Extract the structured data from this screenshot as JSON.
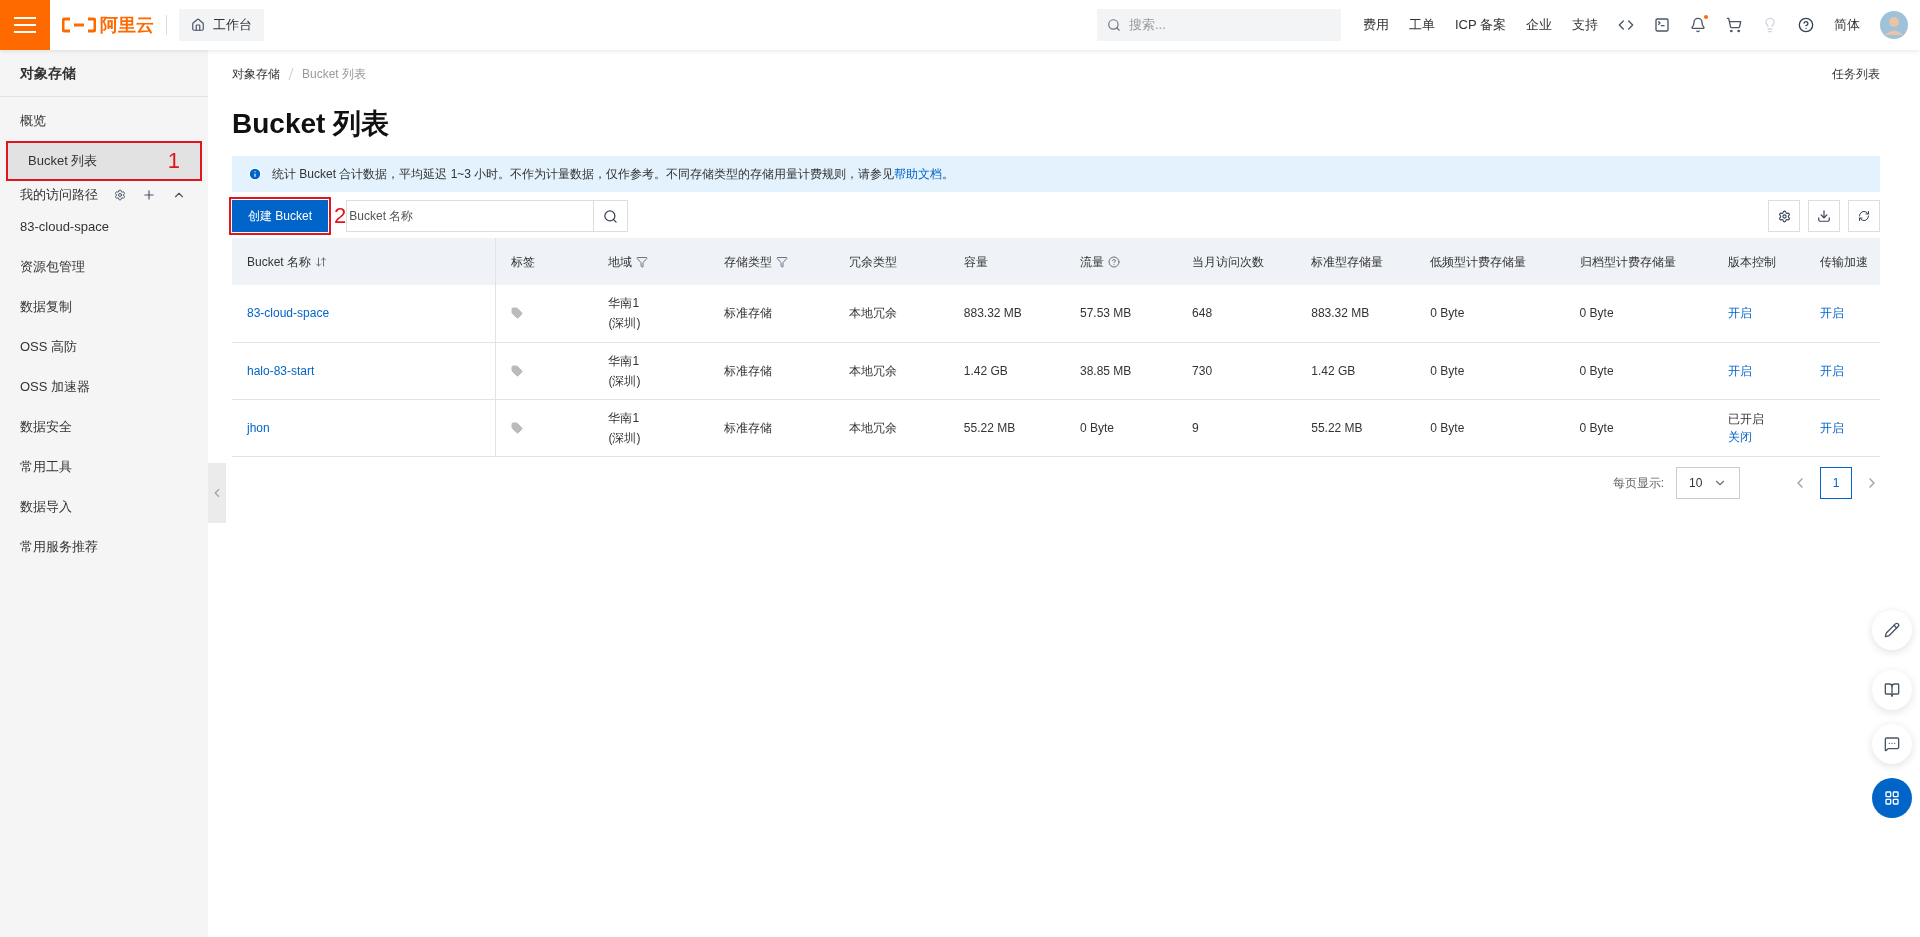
{
  "topbar": {
    "logo_text": "阿里云",
    "workbench": "工作台",
    "search": {
      "placeholder": "搜索..."
    },
    "links": [
      "费用",
      "工单",
      "ICP 备案",
      "企业",
      "支持"
    ],
    "notification_dot": true,
    "language": "简体"
  },
  "sidebar": {
    "title": "对象存储",
    "items": [
      {
        "kind": "link",
        "label": "概览",
        "selected": false
      },
      {
        "kind": "link",
        "label": "Bucket 列表",
        "selected": true,
        "annotation": "1"
      },
      {
        "kind": "section",
        "label": "我的访问路径"
      },
      {
        "kind": "link",
        "label": "83-cloud-space",
        "selected": false
      },
      {
        "kind": "link",
        "label": "资源包管理",
        "selected": false
      },
      {
        "kind": "link",
        "label": "数据复制",
        "selected": false
      },
      {
        "kind": "link",
        "label": "OSS 高防",
        "selected": false
      },
      {
        "kind": "link",
        "label": "OSS 加速器",
        "selected": false
      },
      {
        "kind": "link",
        "label": "数据安全",
        "selected": false
      },
      {
        "kind": "link",
        "label": "常用工具",
        "selected": false
      },
      {
        "kind": "link",
        "label": "数据导入",
        "selected": false
      },
      {
        "kind": "link",
        "label": "常用服务推荐",
        "selected": false
      }
    ]
  },
  "breadcrumb": [
    "对象存储",
    "Bucket 列表"
  ],
  "task_list": "任务列表",
  "title": "Bucket 列表",
  "notice": {
    "text": "统计 Bucket 合计数据，平均延迟 1~3 小时。不作为计量数据，仅作参考。不同存储类型的存储用量计费规则，请参见",
    "link": "帮助文档",
    "end": "。"
  },
  "create_button": {
    "label": "创建 Bucket",
    "annotation": "2"
  },
  "search": {
    "placeholder": "Bucket 名称"
  },
  "table": {
    "columns": [
      {
        "label": "Bucket 名称",
        "kind": "sortable"
      },
      {
        "label": "标签"
      },
      {
        "label": "地域",
        "kind": "filterable"
      },
      {
        "label": "存储类型",
        "kind": "filterable"
      },
      {
        "label": "冗余类型"
      },
      {
        "label": "容量"
      },
      {
        "label": "流量",
        "kind": "help"
      },
      {
        "label": "当月访问次数"
      },
      {
        "label": "标准型存储量"
      },
      {
        "label": "低频型计费存储量"
      },
      {
        "label": "归档型计费存储量"
      },
      {
        "label": "版本控制"
      },
      {
        "label": "传输加速"
      }
    ],
    "rows": [
      {
        "name": "83-cloud-space",
        "region": [
          "华南1",
          "(深圳)"
        ],
        "storage_type": "标准存储",
        "redundancy": "本地冗余",
        "capacity": "883.32 MB",
        "traffic": "57.53 MB",
        "visits": "648",
        "standard": "883.32 MB",
        "infrequent": "0 Byte",
        "archive": "0 Byte",
        "versioning": [
          {
            "kind": "link",
            "text": "开启"
          }
        ],
        "acceleration": "开启"
      },
      {
        "name": "halo-83-start",
        "region": [
          "华南1",
          "(深圳)"
        ],
        "storage_type": "标准存储",
        "redundancy": "本地冗余",
        "capacity": "1.42 GB",
        "traffic": "38.85 MB",
        "visits": "730",
        "standard": "1.42 GB",
        "infrequent": "0 Byte",
        "archive": "0 Byte",
        "versioning": [
          {
            "kind": "link",
            "text": "开启"
          }
        ],
        "acceleration": "开启"
      },
      {
        "name": "jhon",
        "region": [
          "华南1",
          "(深圳)"
        ],
        "storage_type": "标准存储",
        "redundancy": "本地冗余",
        "capacity": "55.22 MB",
        "traffic": "0 Byte",
        "visits": "9",
        "standard": "55.22 MB",
        "infrequent": "0 Byte",
        "archive": "0 Byte",
        "versioning": [
          {
            "kind": "text",
            "text": "已开启"
          },
          {
            "kind": "link",
            "text": "关闭"
          }
        ],
        "acceleration": "开启"
      }
    ]
  },
  "pagination": {
    "label": "每页显示:",
    "page_size": "10",
    "pages": [
      {
        "label": "1",
        "selected": true
      }
    ]
  }
}
